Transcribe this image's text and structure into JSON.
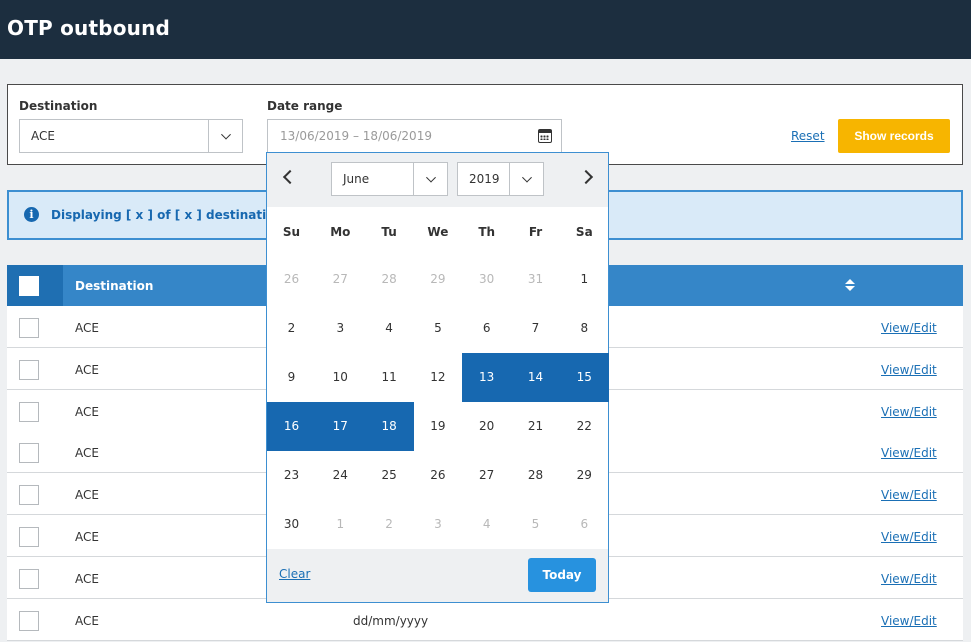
{
  "header": {
    "title": "OTP outbound"
  },
  "filters": {
    "destination_label": "Destination",
    "destination_value": "ACE",
    "date_label": "Date range",
    "date_value": "13/06/2019 – 18/06/2019",
    "reset_label": "Reset",
    "show_label": "Show records"
  },
  "banner": {
    "text": "Displaying [ x ] of [ x ] destinations"
  },
  "table": {
    "header": {
      "destination": "Destination"
    },
    "rows": [
      {
        "destination": "ACE",
        "date": "",
        "action": "View/Edit"
      },
      {
        "destination": "ACE",
        "date": "",
        "action": "View/Edit"
      },
      {
        "destination": "ACE",
        "date": "",
        "action": "View/Edit"
      },
      {
        "destination": "ACE",
        "date": "",
        "action": "View/Edit"
      },
      {
        "destination": "ACE",
        "date": "",
        "action": "View/Edit"
      },
      {
        "destination": "ACE",
        "date": "",
        "action": "View/Edit"
      },
      {
        "destination": "ACE",
        "date": "",
        "action": "View/Edit"
      },
      {
        "destination": "ACE",
        "date": "dd/mm/yyyy",
        "action": "View/Edit"
      }
    ]
  },
  "picker": {
    "month": "June",
    "year": "2019",
    "weekdays": [
      "Su",
      "Mo",
      "Tu",
      "We",
      "Th",
      "Fr",
      "Sa"
    ],
    "days": [
      {
        "n": "26",
        "state": "muted"
      },
      {
        "n": "27",
        "state": "muted"
      },
      {
        "n": "28",
        "state": "muted"
      },
      {
        "n": "29",
        "state": "muted"
      },
      {
        "n": "30",
        "state": "muted"
      },
      {
        "n": "31",
        "state": "muted"
      },
      {
        "n": "1",
        "state": ""
      },
      {
        "n": "2",
        "state": ""
      },
      {
        "n": "3",
        "state": ""
      },
      {
        "n": "4",
        "state": ""
      },
      {
        "n": "5",
        "state": ""
      },
      {
        "n": "6",
        "state": ""
      },
      {
        "n": "7",
        "state": ""
      },
      {
        "n": "8",
        "state": ""
      },
      {
        "n": "9",
        "state": ""
      },
      {
        "n": "10",
        "state": ""
      },
      {
        "n": "11",
        "state": ""
      },
      {
        "n": "12",
        "state": ""
      },
      {
        "n": "13",
        "state": "sel"
      },
      {
        "n": "14",
        "state": "sel"
      },
      {
        "n": "15",
        "state": "sel"
      },
      {
        "n": "16",
        "state": "sel"
      },
      {
        "n": "17",
        "state": "sel"
      },
      {
        "n": "18",
        "state": "sel"
      },
      {
        "n": "19",
        "state": ""
      },
      {
        "n": "20",
        "state": ""
      },
      {
        "n": "21",
        "state": ""
      },
      {
        "n": "22",
        "state": ""
      },
      {
        "n": "23",
        "state": ""
      },
      {
        "n": "24",
        "state": ""
      },
      {
        "n": "25",
        "state": ""
      },
      {
        "n": "26",
        "state": ""
      },
      {
        "n": "27",
        "state": ""
      },
      {
        "n": "28",
        "state": ""
      },
      {
        "n": "29",
        "state": ""
      },
      {
        "n": "30",
        "state": ""
      },
      {
        "n": "1",
        "state": "muted"
      },
      {
        "n": "2",
        "state": "muted"
      },
      {
        "n": "3",
        "state": "muted"
      },
      {
        "n": "4",
        "state": "muted"
      },
      {
        "n": "5",
        "state": "muted"
      },
      {
        "n": "6",
        "state": "muted"
      }
    ],
    "clear_label": "Clear",
    "today_label": "Today"
  },
  "icons": {
    "info": "info-icon",
    "calendar": "calendar-icon",
    "sort": "sort-icon",
    "chevron": "chevron-down-icon"
  },
  "colors": {
    "header_bg": "#1c2e3f",
    "accent_blue": "#1768b0",
    "table_head": "#3586c8",
    "primary_button": "#f7b500",
    "today_button": "#2792df",
    "banner_bg": "#d9eaf8"
  }
}
